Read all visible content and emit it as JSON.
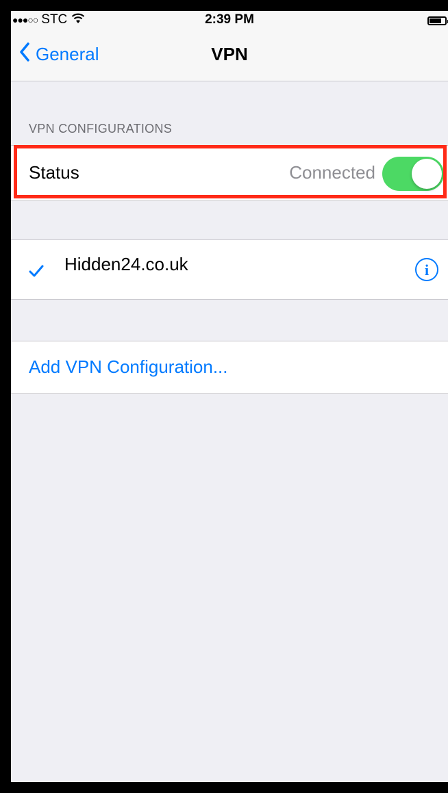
{
  "status_bar": {
    "signal_dots": "●●●○○",
    "carrier": "STC",
    "wifi_icon": "wifi-icon",
    "time": "2:39 PM",
    "battery_icon": "battery-icon"
  },
  "nav": {
    "back_label": "General",
    "title": "VPN"
  },
  "section": {
    "header": "VPN CONFIGURATIONS"
  },
  "status": {
    "label": "Status",
    "value": "Connected",
    "toggle_on": true
  },
  "configs": [
    {
      "name": "Hidden24.co.uk",
      "selected": true
    }
  ],
  "add_configuration_label": "Add VPN Configuration...",
  "colors": {
    "accent": "#007aff",
    "toggle_on": "#4cd964",
    "highlight": "#ff2a17",
    "background": "#efeff4"
  }
}
